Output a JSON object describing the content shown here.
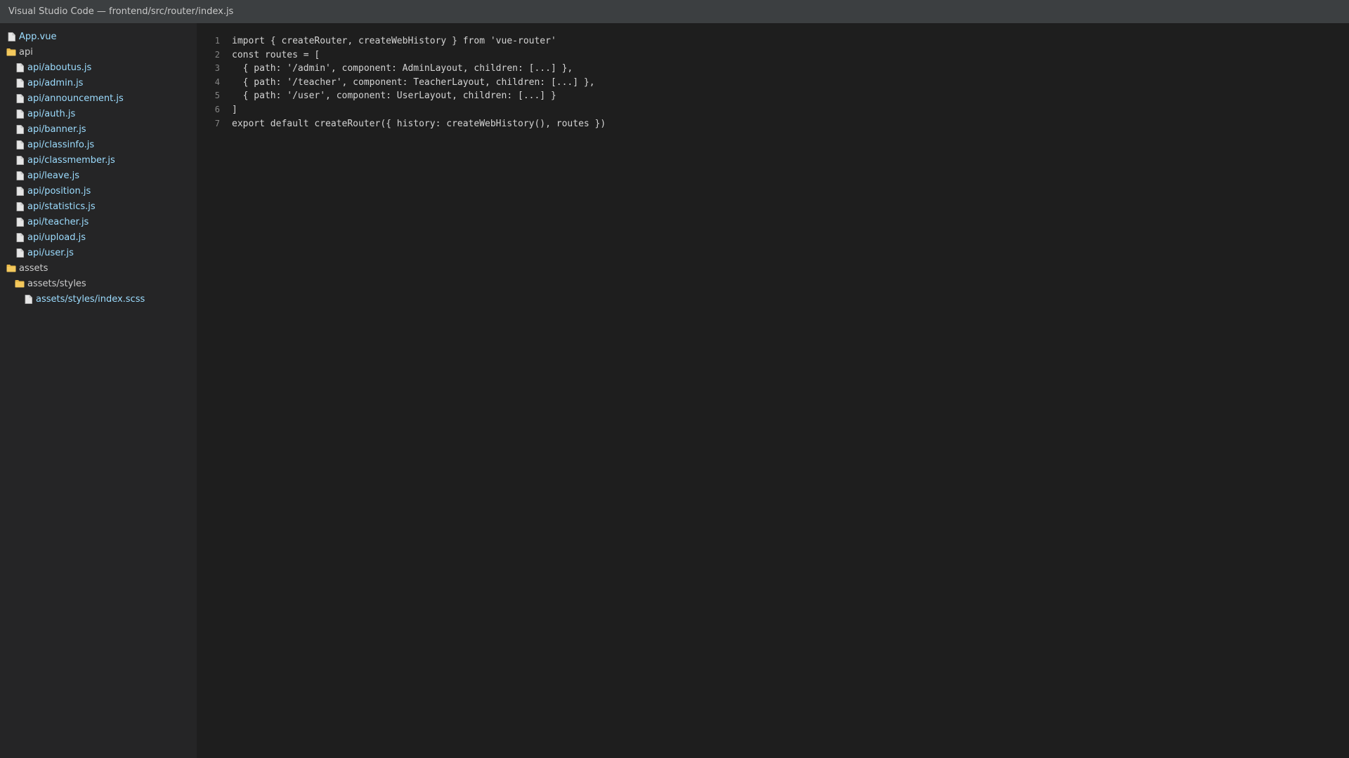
{
  "window": {
    "title": "Visual Studio Code — frontend/src/router/index.js"
  },
  "colors": {
    "titlebar_bg": "#3c3f41",
    "sidebar_bg": "#252526",
    "editor_bg": "#1e1e1e",
    "file_label": "#9cdcfe",
    "folder_label": "#cccccc",
    "folder_icon": "#e8b94a",
    "file_icon": "#e6e6e6"
  },
  "sidebar": {
    "items": [
      {
        "type": "file",
        "level": 0,
        "label": "App.vue",
        "icon": "file-icon"
      },
      {
        "type": "folder",
        "level": 0,
        "label": "api",
        "icon": "folder-icon"
      },
      {
        "type": "file",
        "level": 1,
        "label": "api/aboutus.js",
        "icon": "file-icon"
      },
      {
        "type": "file",
        "level": 1,
        "label": "api/admin.js",
        "icon": "file-icon"
      },
      {
        "type": "file",
        "level": 1,
        "label": "api/announcement.js",
        "icon": "file-icon"
      },
      {
        "type": "file",
        "level": 1,
        "label": "api/auth.js",
        "icon": "file-icon"
      },
      {
        "type": "file",
        "level": 1,
        "label": "api/banner.js",
        "icon": "file-icon"
      },
      {
        "type": "file",
        "level": 1,
        "label": "api/classinfo.js",
        "icon": "file-icon"
      },
      {
        "type": "file",
        "level": 1,
        "label": "api/classmember.js",
        "icon": "file-icon"
      },
      {
        "type": "file",
        "level": 1,
        "label": "api/leave.js",
        "icon": "file-icon"
      },
      {
        "type": "file",
        "level": 1,
        "label": "api/position.js",
        "icon": "file-icon"
      },
      {
        "type": "file",
        "level": 1,
        "label": "api/statistics.js",
        "icon": "file-icon"
      },
      {
        "type": "file",
        "level": 1,
        "label": "api/teacher.js",
        "icon": "file-icon"
      },
      {
        "type": "file",
        "level": 1,
        "label": "api/upload.js",
        "icon": "file-icon"
      },
      {
        "type": "file",
        "level": 1,
        "label": "api/user.js",
        "icon": "file-icon"
      },
      {
        "type": "folder",
        "level": 0,
        "label": "assets",
        "icon": "folder-icon"
      },
      {
        "type": "folder",
        "level": 1,
        "label": "assets/styles",
        "icon": "folder-icon"
      },
      {
        "type": "file",
        "level": 2,
        "label": "assets/styles/index.scss",
        "icon": "file-icon"
      }
    ]
  },
  "editor": {
    "lines": [
      {
        "no": "1",
        "text": "import { createRouter, createWebHistory } from 'vue-router'"
      },
      {
        "no": "2",
        "text": "const routes = ["
      },
      {
        "no": "3",
        "text": "  { path: '/admin', component: AdminLayout, children: [...] },"
      },
      {
        "no": "4",
        "text": "  { path: '/teacher', component: TeacherLayout, children: [...] },"
      },
      {
        "no": "5",
        "text": "  { path: '/user', component: UserLayout, children: [...] }"
      },
      {
        "no": "6",
        "text": "]"
      },
      {
        "no": "7",
        "text": "export default createRouter({ history: createWebHistory(), routes })"
      }
    ]
  }
}
